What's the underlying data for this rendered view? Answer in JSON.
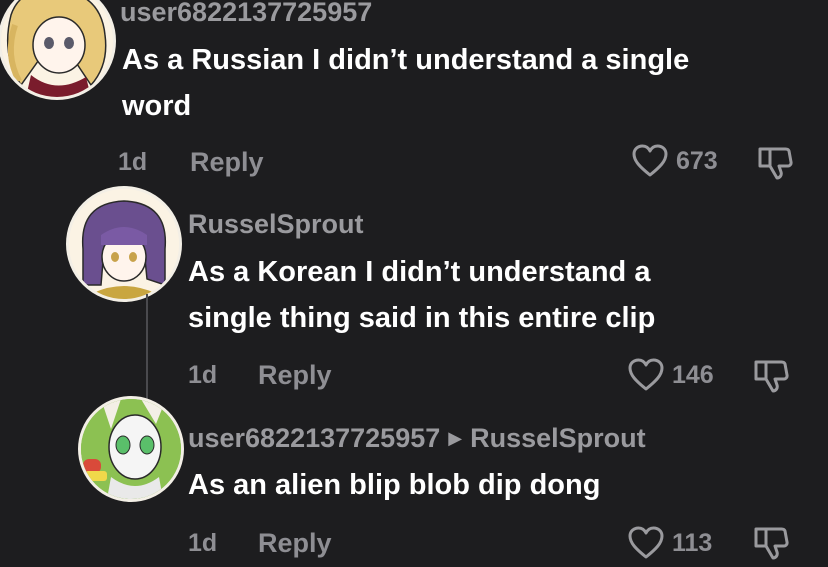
{
  "comments": [
    {
      "username": "user6822137725957",
      "text_line1": "As a Russian I didn’t understand a single",
      "text_line2": "word",
      "time": "1d",
      "reply_label": "Reply",
      "likes": "673",
      "avatar_icon": "blonde-anime-girl-avatar"
    },
    {
      "username": "RusselSprout",
      "text_line1": "As a Korean I didn’t understand a",
      "text_line2": "single thing said in this entire clip",
      "time": "1d",
      "reply_label": "Reply",
      "likes": "146",
      "avatar_icon": "purple-hair-anime-avatar"
    },
    {
      "username": "user6822137725957",
      "reply_to": "RusselSprout",
      "text_line1": "As an alien blip blob dip dong",
      "time": "1d",
      "reply_label": "Reply",
      "likes": "113",
      "avatar_icon": "alien-avatar"
    }
  ],
  "colors": {
    "background": "#1d1d1f",
    "text": "#ffffff",
    "muted": "#8e8e93"
  }
}
